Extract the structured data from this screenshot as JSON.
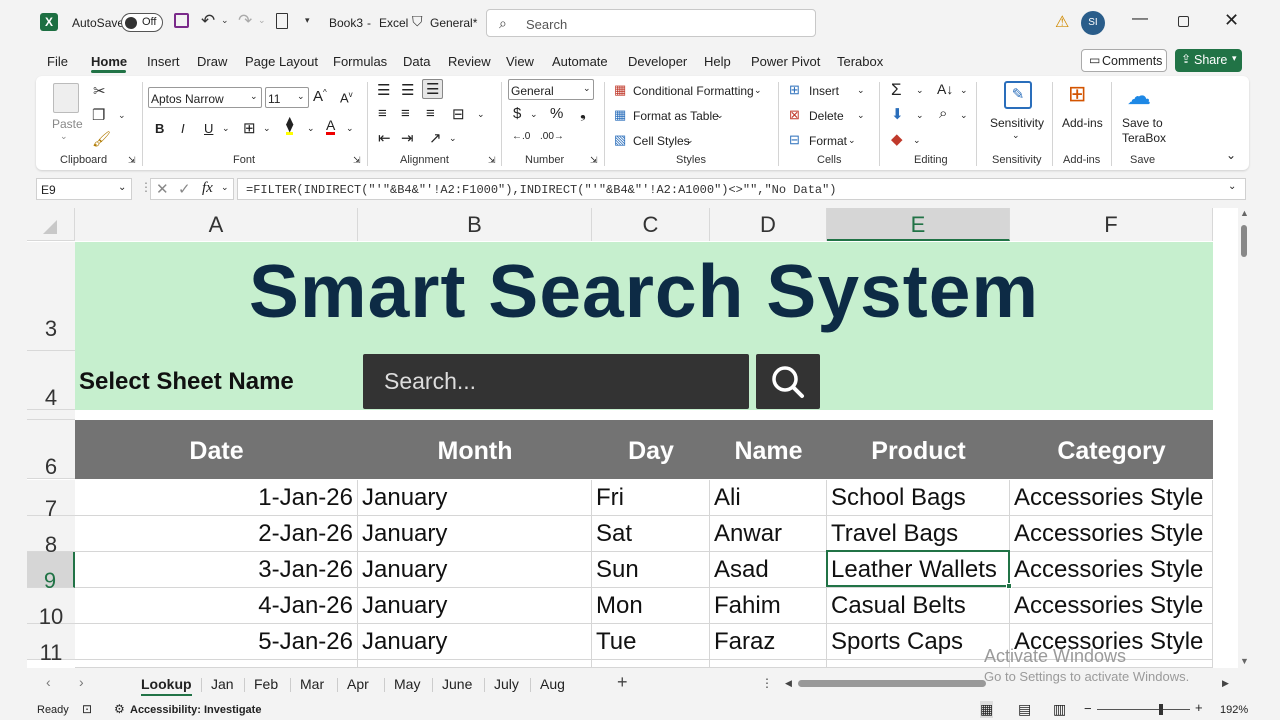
{
  "titlebar": {
    "autosave": "AutoSave",
    "toggle": "Off",
    "filename": "Book3",
    "app": "Excel",
    "sensitivity": "General*",
    "search_placeholder": "Search",
    "user": "SI"
  },
  "menu": [
    "File",
    "Home",
    "Insert",
    "Draw",
    "Page Layout",
    "Formulas",
    "Data",
    "Review",
    "View",
    "Automate",
    "Developer",
    "Help",
    "Power Pivot",
    "Terabox"
  ],
  "menu_active": "Home",
  "actions": {
    "comments": "Comments",
    "share": "Share"
  },
  "ribbon": {
    "clipboard": {
      "paste": "Paste",
      "label": "Clipboard"
    },
    "font": {
      "name": "Aptos Narrow",
      "size": "11",
      "label": "Font"
    },
    "alignment": {
      "label": "Alignment"
    },
    "number": {
      "format": "General",
      "label": "Number"
    },
    "styles": {
      "cond": "Conditional Formatting",
      "table": "Format as Table",
      "cell": "Cell Styles",
      "label": "Styles"
    },
    "cells": {
      "insert": "Insert",
      "delete": "Delete",
      "format": "Format",
      "label": "Cells"
    },
    "editing": {
      "label": "Editing"
    },
    "sensitivity": {
      "btn": "Sensitivity",
      "label": "Sensitivity"
    },
    "addins": {
      "btn": "Add-ins",
      "label": "Add-ins"
    },
    "save": {
      "btn1": "Save to",
      "btn2": "TeraBox",
      "label": "Save"
    }
  },
  "formula": {
    "namebox": "E9",
    "text": "=FILTER(INDIRECT(\"'\"&B4&\"'!A2:F1000\"),INDIRECT(\"'\"&B4&\"'!A2:A1000\")<>\"\",\"No Data\")"
  },
  "columns": [
    "A",
    "B",
    "C",
    "D",
    "E",
    "F"
  ],
  "rows": [
    "3",
    "4",
    "6",
    "7",
    "8",
    "9",
    "10",
    "11"
  ],
  "sheet": {
    "title": "Smart Search System",
    "select_label": "Select Sheet Name",
    "search_placeholder": "Search...",
    "headers": [
      "Date",
      "Month",
      "Day",
      "Name",
      "Product",
      "Category"
    ],
    "data": [
      [
        "1-Jan-26",
        "January",
        "Fri",
        "Ali",
        "School Bags",
        "Accessories Style"
      ],
      [
        "2-Jan-26",
        "January",
        "Sat",
        "Anwar",
        "Travel Bags",
        "Accessories Style"
      ],
      [
        "3-Jan-26",
        "January",
        "Sun",
        "Asad",
        "Leather Wallets",
        "Accessories Style"
      ],
      [
        "4-Jan-26",
        "January",
        "Mon",
        "Fahim",
        "Casual Belts",
        "Accessories Style"
      ],
      [
        "5-Jan-26",
        "January",
        "Tue",
        "Faraz",
        "Sports Caps",
        "Accessories Style"
      ]
    ]
  },
  "tabs": [
    "Lookup",
    "Jan",
    "Feb",
    "Mar",
    "Apr",
    "May",
    "June",
    "July",
    "Aug"
  ],
  "active_tab": "Lookup",
  "watermark": {
    "line1": "Activate Windows",
    "line2": "Go to Settings to activate Windows."
  },
  "status": {
    "ready": "Ready",
    "accessibility": "Accessibility: Investigate",
    "zoom": "192%"
  },
  "colors": {
    "banner": "#c6efce",
    "title": "#0d2b45",
    "header": "#737373",
    "accent": "#217346"
  }
}
